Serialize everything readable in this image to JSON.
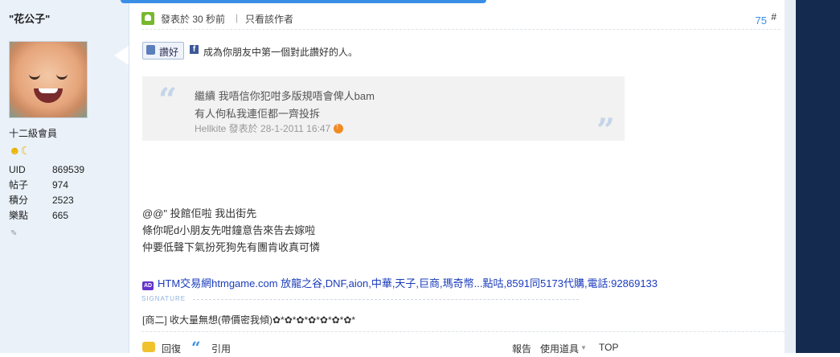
{
  "user": {
    "name": "\"花公子\"",
    "rank": "十二級會員",
    "stats": [
      {
        "label": "UID",
        "value": "869539"
      },
      {
        "label": "帖子",
        "value": "974"
      },
      {
        "label": "積分",
        "value": "2523"
      },
      {
        "label": "樂點",
        "value": "665"
      }
    ]
  },
  "post": {
    "time": "發表於 30 秒前",
    "separator": "|",
    "only_author": "只看該作者",
    "floor": "75",
    "floor_hash": "#"
  },
  "like": {
    "button": "讚好",
    "fb_icon": "f",
    "text": "成為你朋友中第一個對此讚好的人。"
  },
  "quote": {
    "line1": "繼續 我唔信你犯咁多版規唔會俾人bam",
    "line2": "有人佝私我連佢都一齊投拆",
    "meta": "Hellkite 發表於 28-1-2011 16:47"
  },
  "body": {
    "lines": [
      "@@\" 投館佢啦   我出街先",
      "條你呢d小朋友先咁鐘意告來告去嫁啦",
      "仲要低聲下氣扮死狗先有團肯收真可憐"
    ]
  },
  "ad": {
    "icon": "AD",
    "text": "HTM交易網htmgame.com 放龍之谷,DNF,aion,中華,天子,巨商,瑪奇幣...點咕,8591同5173代購,電話:92869133"
  },
  "signature": {
    "label": "SIGNATURE",
    "text": "[商二] 收大量無想(帶價密我傾)✿*✿*✿*✿*✿*✿*✿*"
  },
  "actions": {
    "reply": "回復",
    "quote": "引用",
    "report": "報告",
    "tools": "使用道具",
    "top": "TOP"
  }
}
